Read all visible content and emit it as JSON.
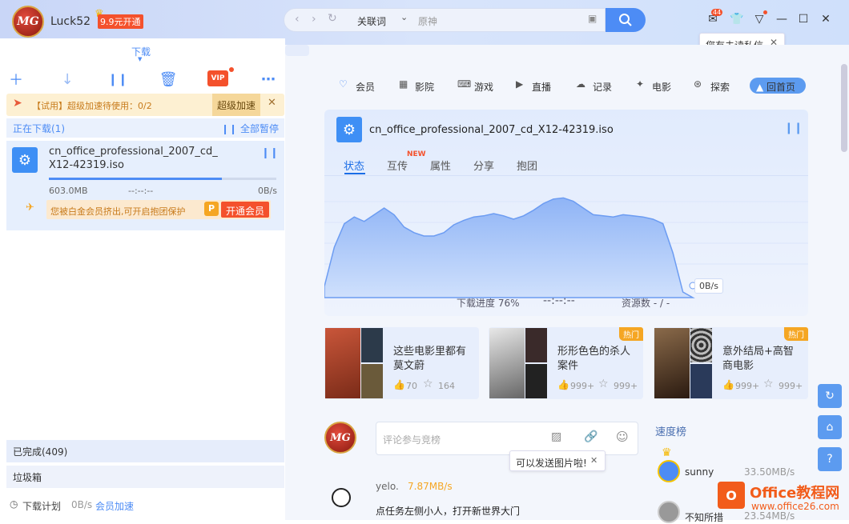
{
  "header": {
    "username": "Luck52",
    "vip_badge": "9.9元开通",
    "search_prefix": "关联词",
    "search_placeholder": "原神",
    "mail_count": "44",
    "unread_tip": "您有未读私信"
  },
  "left": {
    "tab": "下载",
    "alert_text": "【试用】超级加速待使用：0/2",
    "alert_button": "超级加速",
    "downloading": "正在下载(1)",
    "pause_all": "全部暂停",
    "file_name_1": "cn_office_professional_2007_cd_",
    "file_name_2": "X12-42319.iso",
    "size": "603.0MB",
    "eta": "--:--:--",
    "speed": "0B/s",
    "progress": 0.76,
    "member_tip": "您被白金会员挤出,可开启抱团保护",
    "member_button": "开通会员",
    "completed": "已完成(409)",
    "trash": "垃圾箱",
    "schedule": "下载计划",
    "footer_speed": "0B/s",
    "footer_accel": "会员加速"
  },
  "nav": [
    "会员",
    "影院",
    "游戏",
    "直播",
    "记录",
    "电影",
    "探索",
    "回首页"
  ],
  "detail": {
    "file": "cn_office_professional_2007_cd_X12-42319.iso",
    "tabs": [
      "状态",
      "互传",
      "属性",
      "分享",
      "抱团"
    ],
    "new_badge": "NEW",
    "speed_label": "0B/s",
    "progress_text": "下载进度 76%",
    "eta": "--:--:--",
    "sources": "资源数 - / -"
  },
  "chart_data": {
    "type": "area",
    "values": [
      0.1,
      0.45,
      0.66,
      0.72,
      0.68,
      0.74,
      0.8,
      0.74,
      0.63,
      0.58,
      0.55,
      0.55,
      0.58,
      0.65,
      0.69,
      0.72,
      0.73,
      0.75,
      0.73,
      0.7,
      0.73,
      0.78,
      0.84,
      0.88,
      0.89,
      0.86,
      0.8,
      0.74,
      0.73,
      0.72,
      0.74,
      0.73,
      0.72,
      0.7,
      0.66,
      0.4,
      0.05,
      0.0
    ]
  },
  "movies": [
    {
      "title1": "这些电影里都有",
      "title2": "莫文蔚",
      "likes": "70",
      "favs": "164",
      "hot": ""
    },
    {
      "title1": "形形色色的杀人",
      "title2": "案件",
      "likes": "999+",
      "favs": "999+",
      "hot": "热门"
    },
    {
      "title1": "意外结局+高智",
      "title2": "商电影",
      "likes": "999+",
      "favs": "999+",
      "hot": "热门"
    }
  ],
  "comment": {
    "placeholder": "评论参与竞榜",
    "photo_tip": "可以发送图片啦!",
    "user": "yelo.",
    "user_speed": "7.87MB/s",
    "text": "点任务左侧小人，打开新世界大门"
  },
  "ranking": {
    "title": "速度榜",
    "items": [
      {
        "name": "sunny",
        "speed": "33.50MB/s"
      },
      {
        "name": "不知所措",
        "speed": "23.54MB/s"
      }
    ]
  },
  "watermark": {
    "brand": "Office教程网",
    "url": "www.office26.com"
  }
}
